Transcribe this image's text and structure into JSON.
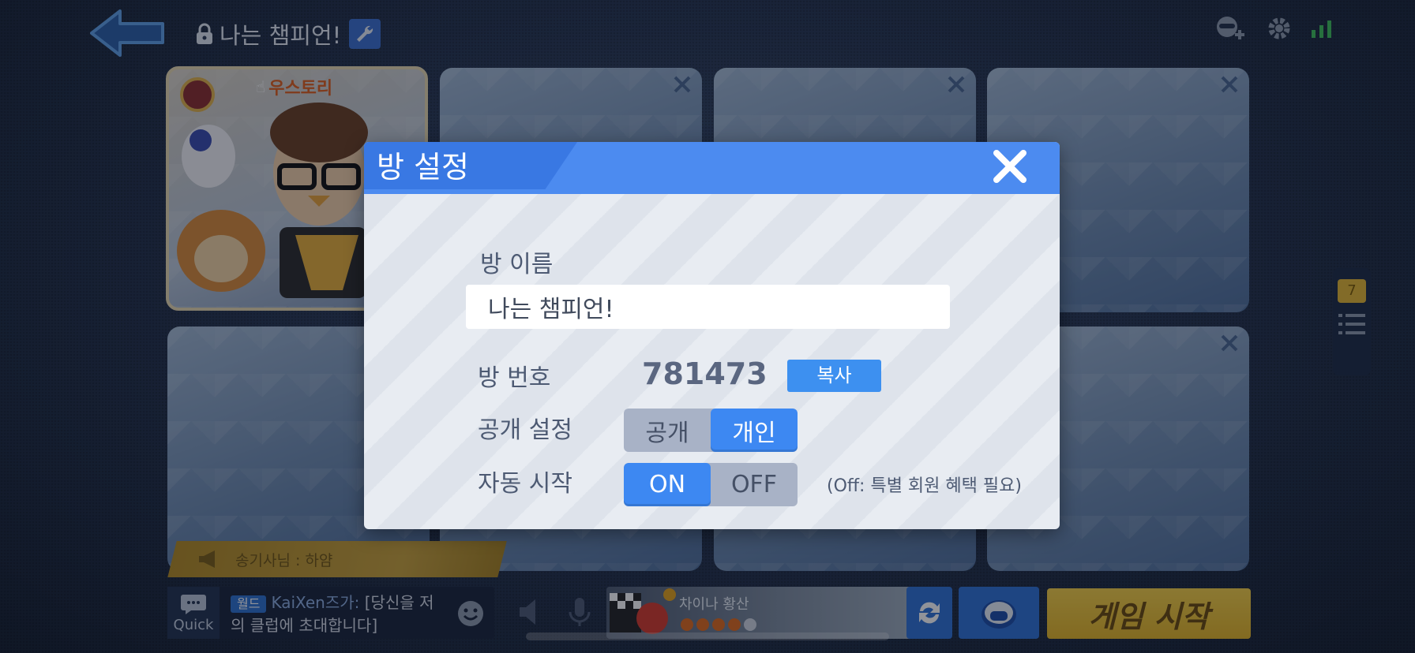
{
  "room": {
    "title": "나는 챔피언!"
  },
  "player": {
    "name": "우스토리"
  },
  "side_panel": {
    "count": "7"
  },
  "notice": {
    "text": "송기사님 : 하얌"
  },
  "chat": {
    "quick_label": "Quick",
    "tag": "월드",
    "sender": "KaiXen즈가:",
    "message": "[당신을 저의 클럽에 초대합니다]"
  },
  "track": {
    "name": "차이나 황산"
  },
  "start_button": {
    "label": "게임 시작"
  },
  "dialog": {
    "title": "방 설정",
    "name_label": "방 이름",
    "name_value": "나는 챔피언!",
    "number_label": "방 번호",
    "number_value": "781473",
    "copy_label": "복사",
    "visibility_label": "공개 설정",
    "visibility_options": [
      "공개",
      "개인"
    ],
    "visibility_selected": "개인",
    "autostart_label": "자동 시작",
    "autostart_options": [
      "ON",
      "OFF"
    ],
    "autostart_selected": "ON",
    "autostart_note": "(Off: 특별 회원 혜택 필요)"
  },
  "colors": {
    "dialog_header": "#4c8bf0",
    "toggle_active": "#3d88f2",
    "start_button": "#e4b525"
  }
}
